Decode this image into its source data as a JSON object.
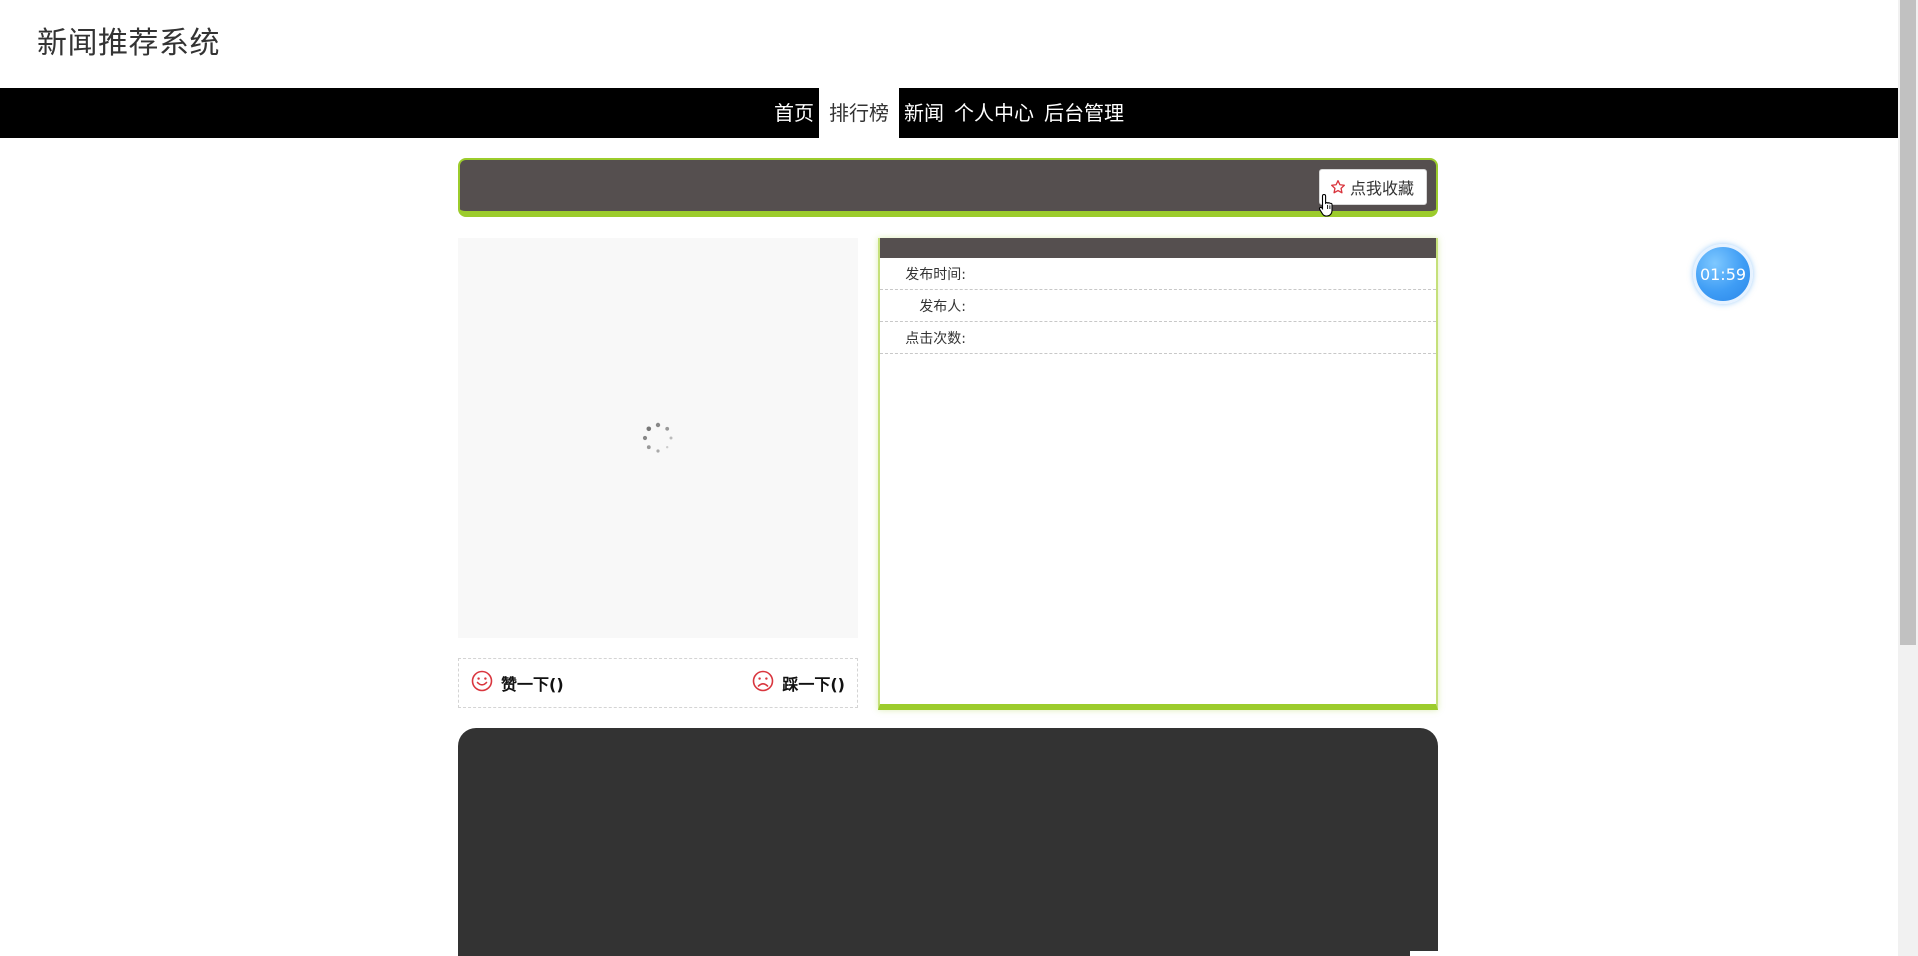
{
  "site": {
    "title": "新闻推荐系统"
  },
  "nav": {
    "items": [
      {
        "label": "首页",
        "active": false
      },
      {
        "label": "排行榜",
        "active": true
      },
      {
        "label": "新闻",
        "active": false
      },
      {
        "label": "个人中心",
        "active": false
      },
      {
        "label": "后台管理",
        "active": false
      }
    ]
  },
  "article": {
    "favorite_label": "点我收藏",
    "publish_time_label": "发布时间:",
    "publisher_label": "发布人:",
    "clicks_label": "点击次数:"
  },
  "votes": {
    "like_label": "赞一下()",
    "dislike_label": "踩一下()"
  },
  "timer": {
    "text": "01:59"
  },
  "icons": {
    "favorite": "star-outline-icon",
    "like": "smile-icon",
    "dislike": "frown-icon",
    "loading": "spinner-icon",
    "cursor": "hand-pointer-icon"
  },
  "colors": {
    "nav_bg": "#000000",
    "panel_header": "#554f4f",
    "accent_green": "#9ccc2c",
    "vote_icon_red": "#d9363e",
    "timer_blue": "#3f9df5",
    "video_bg": "#333333"
  }
}
